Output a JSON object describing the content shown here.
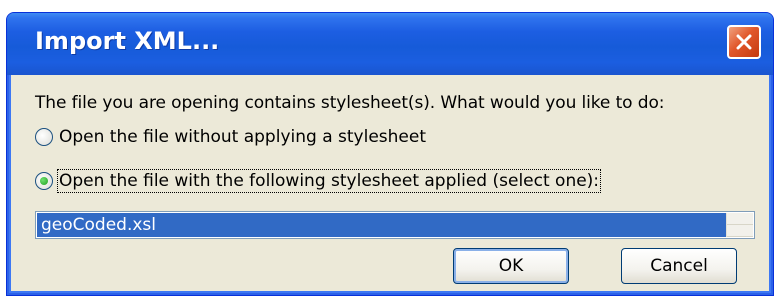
{
  "window": {
    "title": "Import XML..."
  },
  "dialog": {
    "prompt": "The file you are opening contains stylesheet(s).  What would you like to do:",
    "options": [
      {
        "label": "Open the file without applying a stylesheet",
        "checked": false
      },
      {
        "label": "Open the file with the following stylesheet applied (select one):",
        "checked": true
      }
    ],
    "stylesheets": [
      "geoCoded.xsl"
    ],
    "selected_stylesheet": "geoCoded.xsl",
    "ok_label": "OK",
    "cancel_label": "Cancel"
  },
  "colors": {
    "titlebar": "#1d5ee2",
    "face": "#ece9d8",
    "selection": "#316ac5",
    "close": "#e1572a"
  },
  "icons": {
    "close": "close-icon"
  }
}
